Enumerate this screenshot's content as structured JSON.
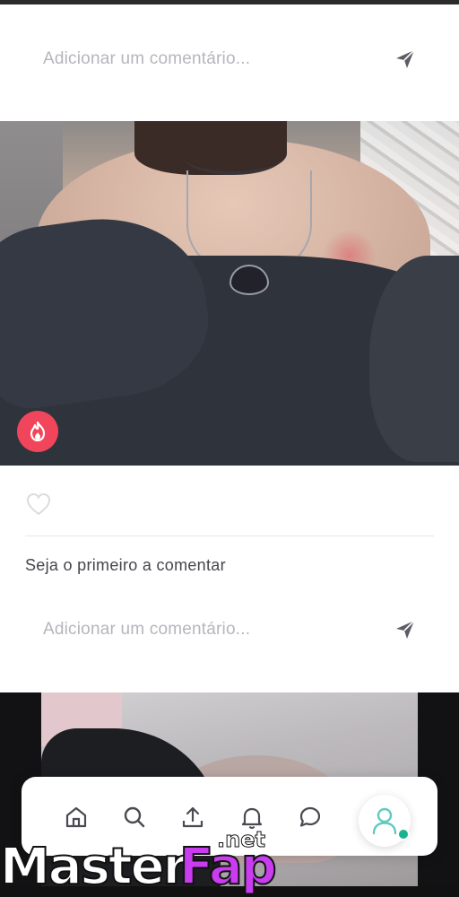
{
  "comment_box_top": {
    "placeholder": "Adicionar um comentário..."
  },
  "post": {
    "like_count": "",
    "first_comment_prompt": "Seja o primeiro a comentar"
  },
  "comment_box_bottom": {
    "placeholder": "Adicionar um comentário..."
  },
  "bottom_nav": {
    "items": [
      "home-icon",
      "search-icon",
      "upload-icon",
      "bell-icon",
      "chat-icon"
    ],
    "profile_icon": "user-icon"
  },
  "watermark": {
    "master": "Master",
    "fap": "Fap",
    "net": ".net"
  },
  "colors": {
    "accent_red": "#f0455a",
    "online_green": "#1bb08e",
    "placeholder_gray": "#b5b5bd"
  }
}
